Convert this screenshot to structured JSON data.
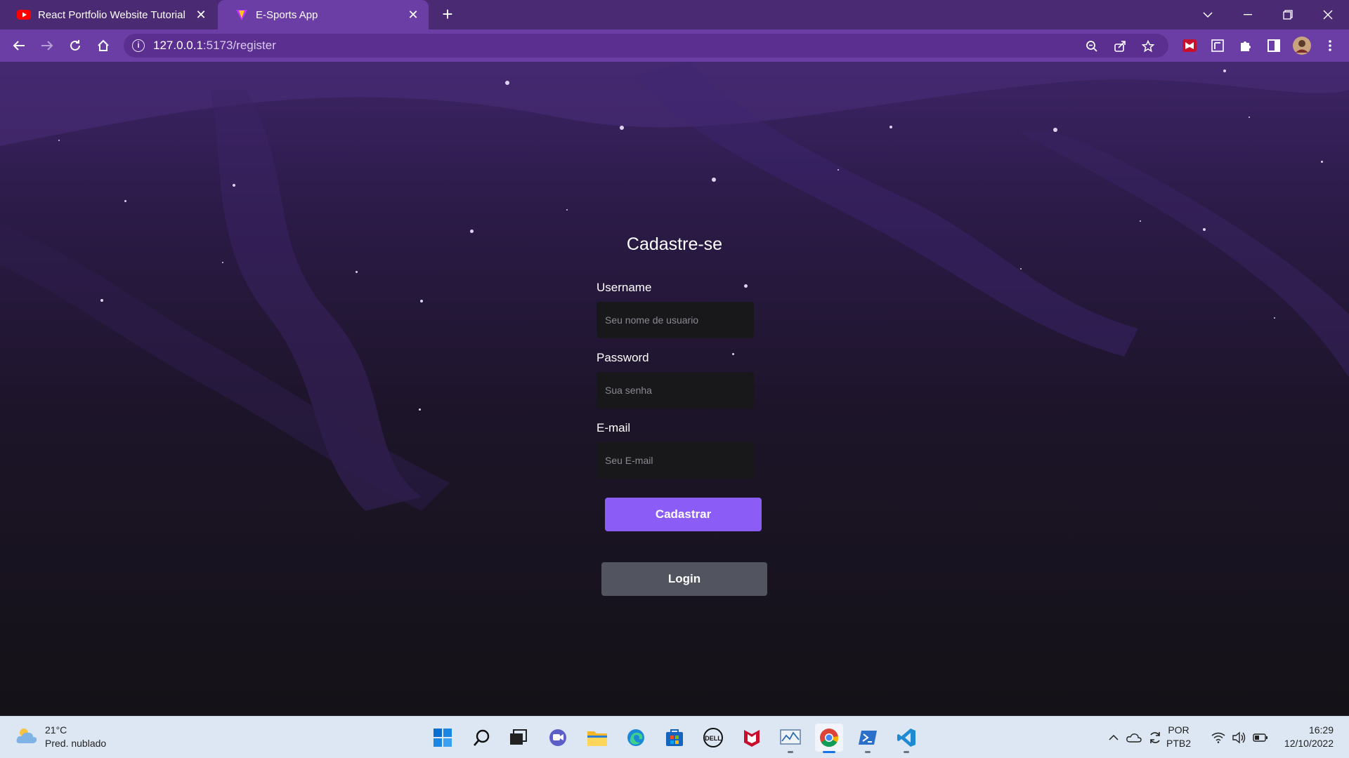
{
  "browser": {
    "tabs": [
      {
        "title": "React Portfolio Website Tutorial |",
        "favicon": "youtube-icon",
        "active": false
      },
      {
        "title": "E-Sports App",
        "favicon": "vite-icon",
        "active": true
      }
    ],
    "url_host": "127.0.0.1",
    "url_path": ":5173/register"
  },
  "form": {
    "title": "Cadastre-se",
    "username_label": "Username",
    "username_placeholder": "Seu nome de usuario",
    "password_label": "Password",
    "password_placeholder": "Sua senha",
    "email_label": "E-mail",
    "email_placeholder": "Seu E-mail",
    "register_button": "Cadastrar",
    "login_button": "Login"
  },
  "taskbar": {
    "weather_temp": "21°C",
    "weather_desc": "Pred. nublado",
    "lang_1": "POR",
    "lang_2": "PTB2",
    "time": "16:29",
    "date": "12/10/2022"
  },
  "colors": {
    "accent": "#8b5cf6",
    "browser_frame": "#6b3ea6",
    "login_button": "#52555f"
  }
}
